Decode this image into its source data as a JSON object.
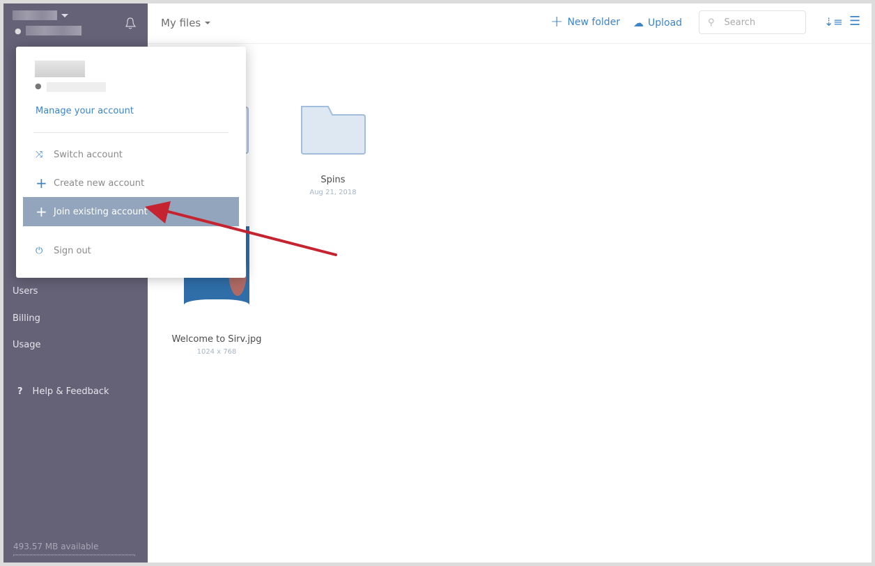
{
  "sidebar": {
    "nav": [
      {
        "label": "Users"
      },
      {
        "label": "Billing"
      },
      {
        "label": "Usage"
      }
    ],
    "help": "Help & Feedback",
    "storage": "493.57 MB available"
  },
  "header": {
    "title": "My files",
    "new_folder": "New folder",
    "upload": "Upload",
    "search_placeholder": "Search"
  },
  "files": [
    {
      "name": "Spins",
      "meta": "Aug 21, 2018",
      "type": "folder"
    },
    {
      "name": "Welcome to Sirv.jpg",
      "meta": "1024 x 768",
      "type": "image"
    }
  ],
  "dropdown": {
    "manage": "Manage your account",
    "items": [
      {
        "label": "Switch account",
        "icon": "shuffle-icon"
      },
      {
        "label": "Create new account",
        "icon": "plus-icon"
      },
      {
        "label": "Join existing account",
        "icon": "plus-icon",
        "active": true
      },
      {
        "label": "Sign out",
        "icon": "power-icon"
      }
    ]
  },
  "colors": {
    "sidebar": "#656176",
    "accent": "#3d84c6",
    "highlight": "#93a5bc",
    "arrow": "#c4232f"
  }
}
